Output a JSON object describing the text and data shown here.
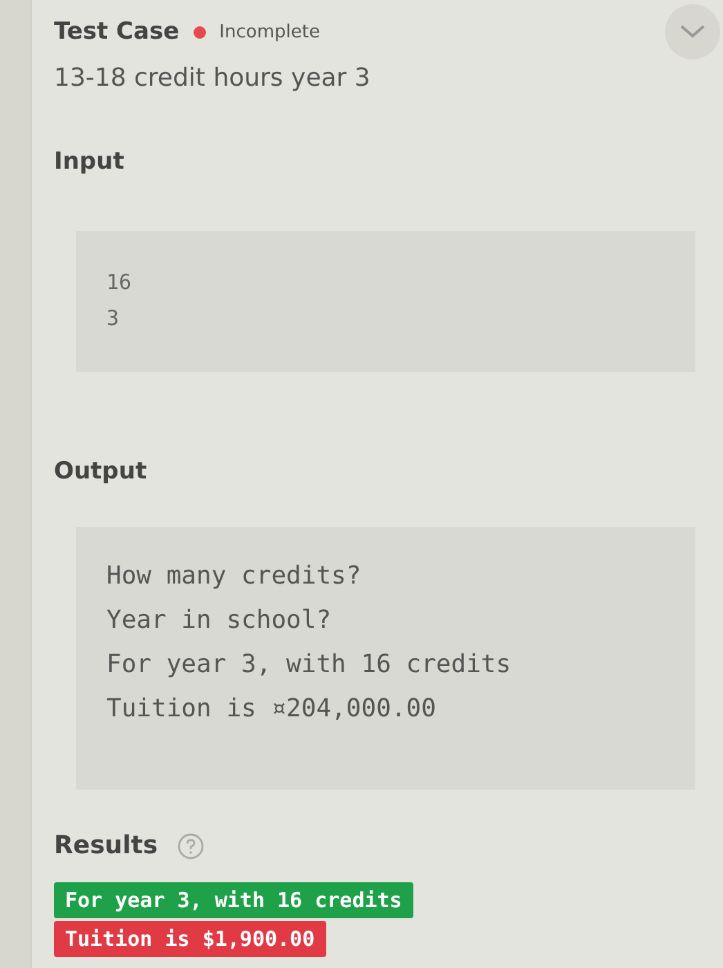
{
  "test_case": {
    "title": "Test Case",
    "status": {
      "text": "Incomplete",
      "color": "#e5484d"
    },
    "subtitle": "13-18 credit hours year 3",
    "expanded": true
  },
  "input": {
    "label": "Input",
    "lines": [
      "16",
      "3"
    ]
  },
  "output": {
    "label": "Output",
    "lines": [
      "How many credits?",
      "Year in school?",
      "For year 3, with 16 credits",
      "Tuition is ¤204,000.00"
    ]
  },
  "results": {
    "label": "Results",
    "lines": [
      {
        "text": "For year 3, with 16 credits",
        "color": "#1fa14a"
      },
      {
        "text": "Tuition is $1,900.00",
        "color": "#e03a45"
      }
    ]
  }
}
